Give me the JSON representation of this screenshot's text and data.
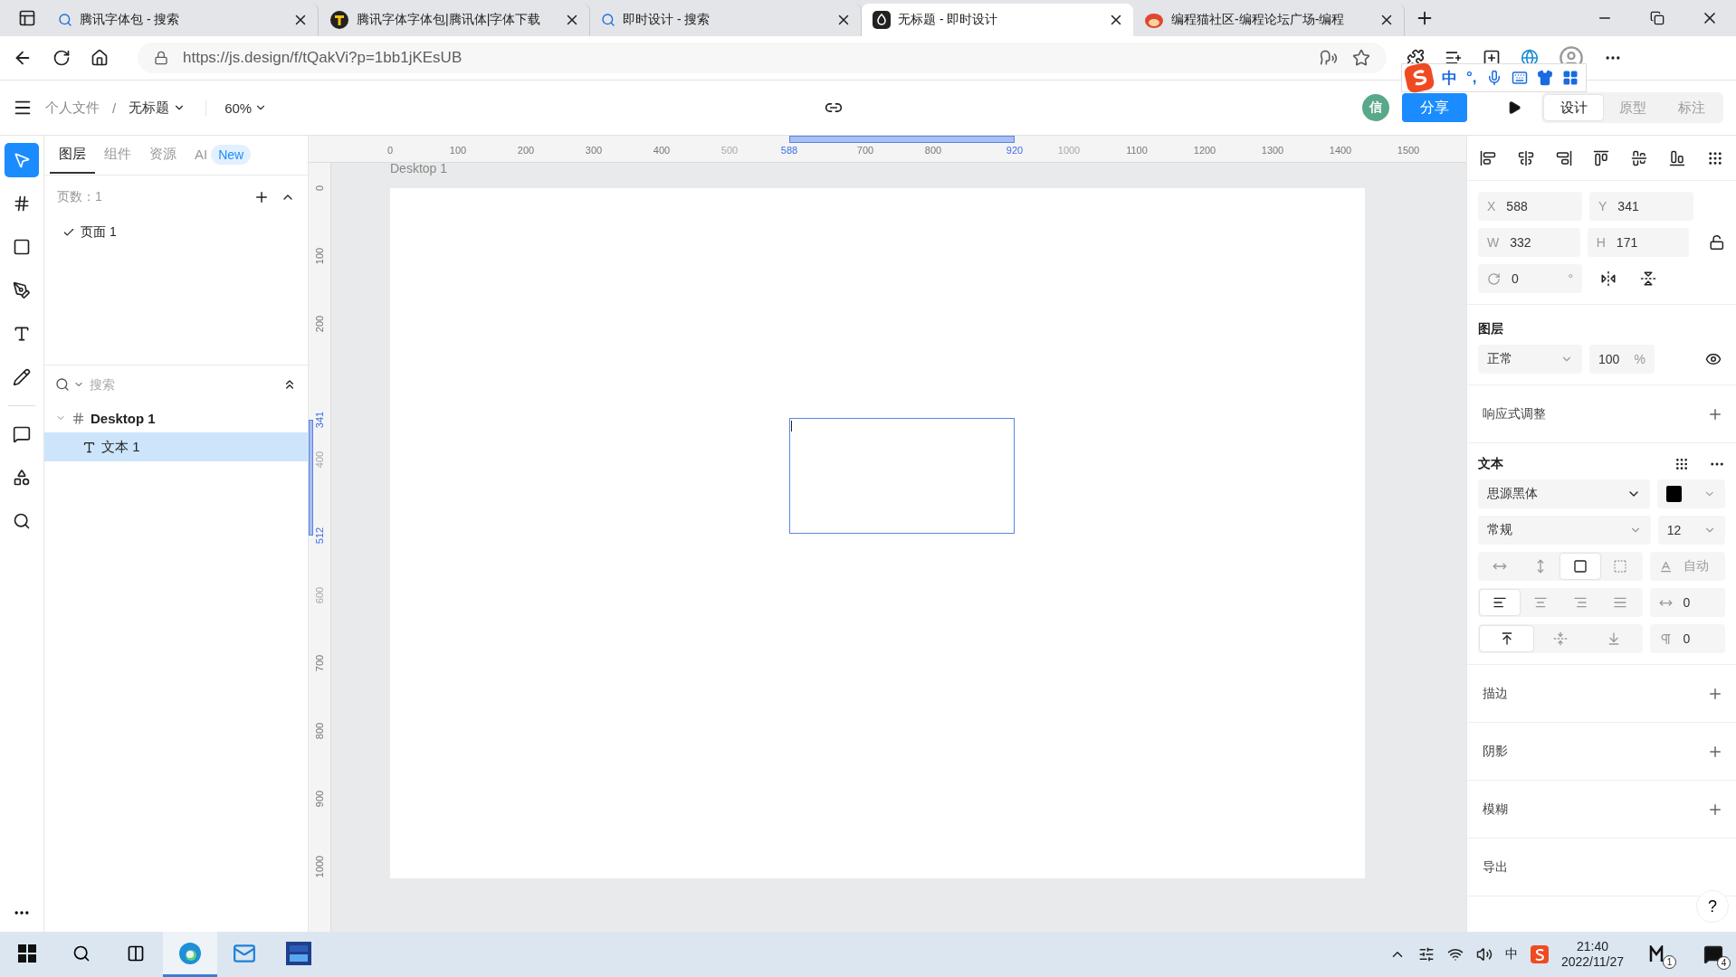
{
  "browser": {
    "tabs": [
      {
        "title": "腾讯字体包 - 搜索",
        "kind": "search",
        "selected": false
      },
      {
        "title": "腾讯字体字体包|腾讯体|字体下载",
        "kind": "font",
        "selected": false
      },
      {
        "title": "即时设计 - 搜索",
        "kind": "search",
        "selected": false
      },
      {
        "title": "无标题 - 即时设计",
        "kind": "app",
        "selected": true
      },
      {
        "title": "编程猫社区-编程论坛广场-编程",
        "kind": "mascot",
        "selected": false
      }
    ],
    "address": "https://js.design/f/tQakVi?p=1bb1jKEsUB"
  },
  "ime_toolbar": {
    "mode": "中",
    "punctuation": "°,"
  },
  "app_bar": {
    "breadcrumb_parent": "个人文件",
    "separator": "/",
    "file_name": "无标题",
    "zoom": "60%",
    "avatar": "信",
    "share": "分享",
    "modes": [
      {
        "label": "设计",
        "selected": true
      },
      {
        "label": "原型",
        "selected": false
      },
      {
        "label": "标注",
        "selected": false
      }
    ]
  },
  "tools": [
    {
      "kind": "select",
      "selected": true
    },
    {
      "kind": "frame",
      "selected": false
    },
    {
      "kind": "shape",
      "selected": false
    },
    {
      "kind": "pen",
      "selected": false
    },
    {
      "kind": "text",
      "selected": false
    },
    {
      "kind": "pencil",
      "selected": false
    }
  ],
  "secondary_tools": [
    {
      "kind": "comment",
      "selected": false
    },
    {
      "kind": "components",
      "selected": false
    },
    {
      "kind": "search",
      "selected": false
    }
  ],
  "left_panel": {
    "tabs": [
      {
        "label": "图层",
        "selected": true
      },
      {
        "label": "组件",
        "selected": false
      },
      {
        "label": "资源",
        "selected": false
      },
      {
        "label": "AI",
        "badge": "New",
        "selected": false
      }
    ],
    "page_count": "页数：1",
    "pages": [
      {
        "name": "页面 1",
        "selected": true
      }
    ],
    "search_placeholder": "搜索",
    "layers": [
      {
        "name": "Desktop 1",
        "kind": "frame",
        "expanded": true,
        "selected": false,
        "children": [
          {
            "name": "文本 1",
            "kind": "text",
            "selected": true
          }
        ]
      }
    ]
  },
  "canvas": {
    "frame_label": "Desktop 1",
    "top_ruler": [
      {
        "label": "0",
        "kind": "normal"
      },
      {
        "label": "100",
        "kind": "normal"
      },
      {
        "label": "200",
        "kind": "normal"
      },
      {
        "label": "300",
        "kind": "normal"
      },
      {
        "label": "400",
        "kind": "normal"
      },
      {
        "label": "500",
        "kind": "faded"
      },
      {
        "label": "588",
        "kind": "selected"
      },
      {
        "label": "700",
        "kind": "normal"
      },
      {
        "label": "800",
        "kind": "normal"
      },
      {
        "label": "920",
        "kind": "selected"
      },
      {
        "label": "1000",
        "kind": "faded"
      },
      {
        "label": "1100",
        "kind": "normal"
      },
      {
        "label": "1200",
        "kind": "normal"
      },
      {
        "label": "1300",
        "kind": "normal"
      },
      {
        "label": "1400",
        "kind": "normal"
      },
      {
        "label": "1500",
        "kind": "normal"
      }
    ],
    "left_ruler": [
      {
        "label": "0",
        "kind": "normal"
      },
      {
        "label": "100",
        "kind": "normal"
      },
      {
        "label": "200",
        "kind": "normal"
      },
      {
        "label": "341",
        "kind": "selected"
      },
      {
        "label": "400",
        "kind": "faded"
      },
      {
        "label": "512",
        "kind": "selected"
      },
      {
        "label": "600",
        "kind": "faded"
      },
      {
        "label": "700",
        "kind": "normal"
      },
      {
        "label": "800",
        "kind": "normal"
      },
      {
        "label": "900",
        "kind": "normal"
      },
      {
        "label": "1000",
        "kind": "normal"
      }
    ]
  },
  "inspector": {
    "geometry": [
      {
        "axis": "X",
        "value": "588"
      },
      {
        "axis": "Y",
        "value": "341"
      },
      {
        "axis": "W",
        "value": "332"
      },
      {
        "axis": "H",
        "value": "171"
      }
    ],
    "rotation": {
      "value": "0",
      "unit": "°"
    },
    "layer": {
      "title": "图层",
      "blend": "正常",
      "opacity": "100",
      "unit": "%"
    },
    "responsive": {
      "title": "响应式调整"
    },
    "text": {
      "title": "文本",
      "font": "思源黑体",
      "weight": "常规",
      "size": "12",
      "sizing": [
        {
          "kind": "auto-width",
          "selected": false
        },
        {
          "kind": "auto-height",
          "selected": false
        },
        {
          "kind": "fixed",
          "selected": true
        },
        {
          "kind": "truncate",
          "selected": false
        }
      ],
      "auto_label": "自动",
      "align": [
        {
          "kind": "left",
          "selected": true
        },
        {
          "kind": "center",
          "selected": false
        },
        {
          "kind": "right",
          "selected": false
        },
        {
          "kind": "justify",
          "selected": false
        }
      ],
      "letter_spacing": "0",
      "vertical_align": [
        {
          "kind": "top",
          "selected": true
        },
        {
          "kind": "middle",
          "selected": false
        },
        {
          "kind": "bottom",
          "selected": false
        }
      ],
      "paragraph_spacing": "0"
    },
    "sections": [
      {
        "title": "描边",
        "addable": true
      },
      {
        "title": "阴影",
        "addable": true
      },
      {
        "title": "模糊",
        "addable": true
      },
      {
        "title": "导出",
        "addable": false
      }
    ],
    "help": "?"
  },
  "taskbar": {
    "apps": [
      {
        "kind": "search",
        "selected": false
      },
      {
        "kind": "taskview",
        "selected": false
      },
      {
        "kind": "edge",
        "selected": true
      },
      {
        "kind": "mail",
        "selected": false
      },
      {
        "kind": "devcpp",
        "selected": false
      }
    ],
    "ime": "中",
    "time": "21:40",
    "date": "2022/11/27",
    "app_badge": "1",
    "notification_badge": "4"
  }
}
